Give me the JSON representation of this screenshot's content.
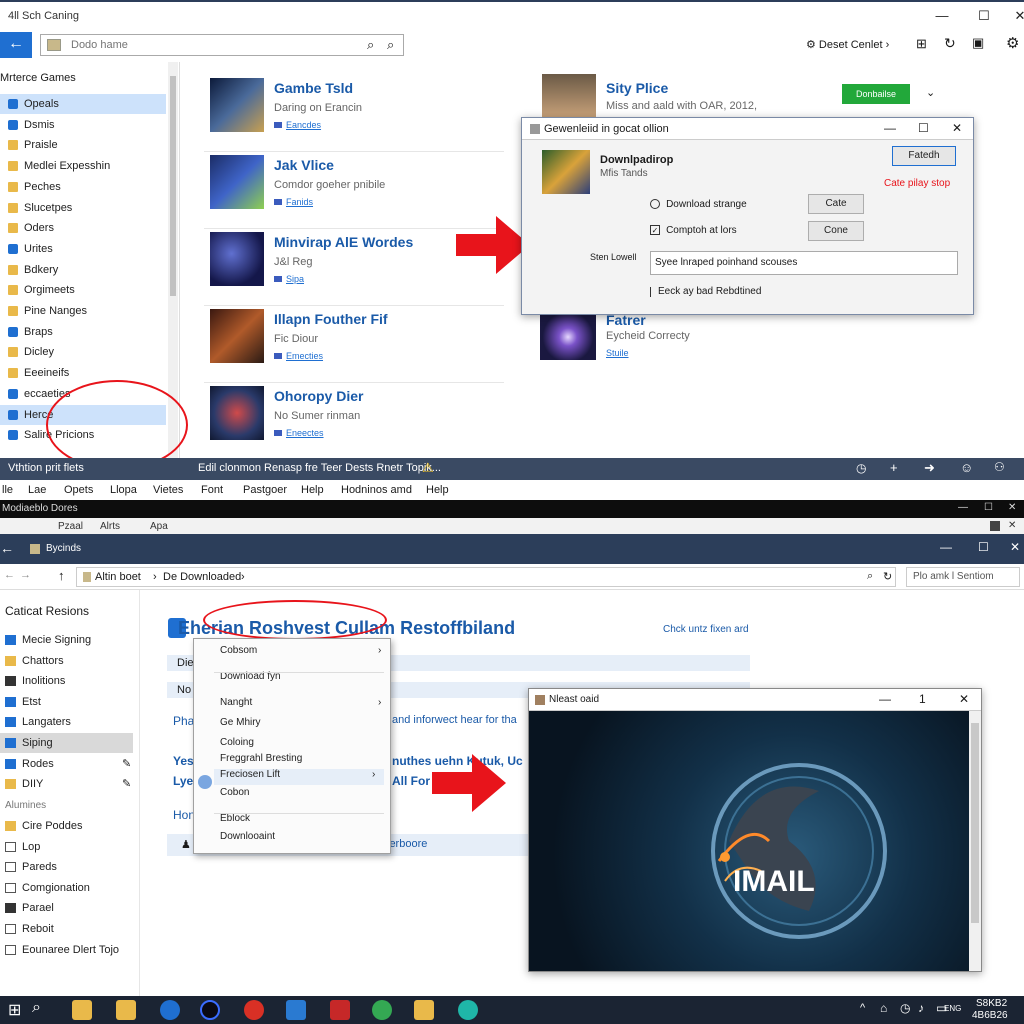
{
  "top_window": {
    "title": "4ll Sch Caning",
    "controls": [
      "—",
      "☐",
      "✕"
    ],
    "search": {
      "placeholder": "Dodo hame"
    },
    "toolbar_right": "Deset Cenlet ›",
    "sidebar": {
      "header": "Mrterce Games",
      "items": [
        {
          "label": "Opeals",
          "icon": "blue",
          "selected": true
        },
        {
          "label": "Dsmis",
          "icon": "blue"
        },
        {
          "label": "Praisle",
          "icon": "folder"
        },
        {
          "label": "Medlei Expesshin",
          "icon": "folder"
        },
        {
          "label": "Peches",
          "icon": "folder"
        },
        {
          "label": "Slucetpes",
          "icon": "folder"
        },
        {
          "label": "Oders",
          "icon": "folder"
        },
        {
          "label": "Urites",
          "icon": "blue"
        },
        {
          "label": "Bdkery",
          "icon": "folder"
        },
        {
          "label": "Orgimeets",
          "icon": "folder"
        },
        {
          "label": "Pine Nanges",
          "icon": "folder"
        },
        {
          "label": "Braps",
          "icon": "blue"
        },
        {
          "label": "Dicley",
          "icon": "folder"
        },
        {
          "label": "Eeeineifs",
          "icon": "folder"
        },
        {
          "label": "eccaeties",
          "icon": "blue"
        },
        {
          "label": "Herce",
          "icon": "blue",
          "selected": true
        },
        {
          "label": "Salire Pricions",
          "icon": "blue"
        }
      ]
    },
    "games": [
      {
        "title": "Gambe Tsld",
        "sub": "Daring on Erancin",
        "link": "Eancdes"
      },
      {
        "title": "Jak Vlice",
        "sub": "Comdor goeher pnibile",
        "link": "Fanids"
      },
      {
        "title": "Minvirap AlE Wordes",
        "sub": "J&l Reg",
        "link": "Sipa"
      },
      {
        "title": "Illapn Fouther Fif",
        "sub": "Fic Diour",
        "link": "Emecties"
      },
      {
        "title": "Ohoropy Dier",
        "sub": "No Sumer rinman",
        "link": "Eneectes"
      }
    ],
    "right_card": {
      "title": "Sity Plice",
      "sub": "Miss and aald with OAR, 2012,",
      "button": "Donbailse"
    },
    "right_card2": {
      "title": "Fatrer",
      "sub": "Eycheid Correcty",
      "link": "Stuile"
    },
    "dialog": {
      "title": "Gewenleiid in gocat ollion",
      "app_name": "Downlpadirop",
      "app_sub": "Mfis Tands",
      "button_top": "Fatedh",
      "red_text": "Cate pilay stop",
      "option1": "Download strange",
      "option2": "Comptoh at lors",
      "btn1": "Cate",
      "btn2": "Cone",
      "field_label": "Sten Lowell",
      "field_value": "Syee lnraped poinhand scouses",
      "checkbox_label": "Eeck ay bad Rebdtined"
    },
    "statusbar": {
      "left": "Vthtion prit flets",
      "center": "Edil clonmon Renasp fre Teer Dests Rnetr Topik..."
    },
    "menubar": [
      "lle",
      "Lae",
      "Opets",
      "Llopa",
      "Vietes",
      "Font",
      "Pastgoer",
      "Help",
      "Hodninos amd",
      "Help"
    ]
  },
  "bottom_window": {
    "strip_title": "Modiaeblo Dores",
    "strip_tabs": [
      "Pzaal",
      "Alrts",
      "Apa"
    ],
    "title": "Bycinds",
    "breadcrumb": [
      "Altin boet",
      "De Downloaded"
    ],
    "search_placeholder": "Plo amk l Sentiom",
    "sidebar": {
      "header": "Caticat Resions",
      "items": [
        {
          "label": "Mecie Signing",
          "icon": "blue"
        },
        {
          "label": "Chattors",
          "icon": "folder"
        },
        {
          "label": "Inolitions",
          "icon": "dark"
        },
        {
          "label": "Etst",
          "icon": "blue"
        },
        {
          "label": "Langaters",
          "icon": "blue"
        },
        {
          "label": "Siping",
          "icon": "blue",
          "selected": true
        },
        {
          "label": "Rodes",
          "icon": "blue"
        },
        {
          "label": "DIIY",
          "icon": "folder"
        }
      ],
      "header2": "Alumines",
      "items2": [
        {
          "label": "Cire Poddes",
          "icon": "folder"
        },
        {
          "label": "Lop",
          "icon": "outline"
        },
        {
          "label": "Pareds",
          "icon": "outline"
        },
        {
          "label": "Comgionation",
          "icon": "outline"
        },
        {
          "label": "Parael",
          "icon": "dark"
        },
        {
          "label": "Reboit",
          "icon": "outline"
        },
        {
          "label": "Eounaree Dlert Tojo",
          "icon": "outline"
        }
      ]
    },
    "heading": "Eherian Roshvest Cullam Restoffbiland",
    "heading_link": "Chck untz fixen ard",
    "content_rows": [
      "Die",
      "No",
      "Pha",
      "Yes",
      "Lye",
      "Hon"
    ],
    "content_line1": "and inforwect hear for tha",
    "content_line2": "nuthes uehn Kutuk, Uc",
    "content_line3": "All For",
    "content_line4": "ierboore",
    "context_menu": [
      {
        "label": "Cobsom",
        "arrow": true
      },
      {
        "label": "Download fyn",
        "arrow": false
      },
      {
        "label": "Nanght",
        "arrow": true
      },
      {
        "label": "Ge Mhiry",
        "arrow": false
      },
      {
        "label": "Coloing",
        "arrow": false
      },
      {
        "label": "Freggrahl Bresting",
        "arrow": false
      },
      {
        "label": "Freciosen Lift",
        "arrow": true
      },
      {
        "label": "Cobon",
        "arrow": false
      },
      {
        "label": "Eblock",
        "arrow": false
      },
      {
        "label": "Downlooaint",
        "arrow": false
      }
    ],
    "viewer": {
      "title": "Nleast oaid",
      "controls": [
        "—",
        "1",
        "✕"
      ],
      "art_text": "IMAIL"
    }
  },
  "taskbar": {
    "time": "S8KB2",
    "date": "4B6B26",
    "tray": [
      "^",
      "⌂",
      "◷",
      "♪",
      "▭",
      "ENG"
    ]
  },
  "colors": {
    "accent": "#1f6fd1",
    "status": "#3a4a63",
    "red": "#e8141b",
    "green": "#22a83a"
  }
}
